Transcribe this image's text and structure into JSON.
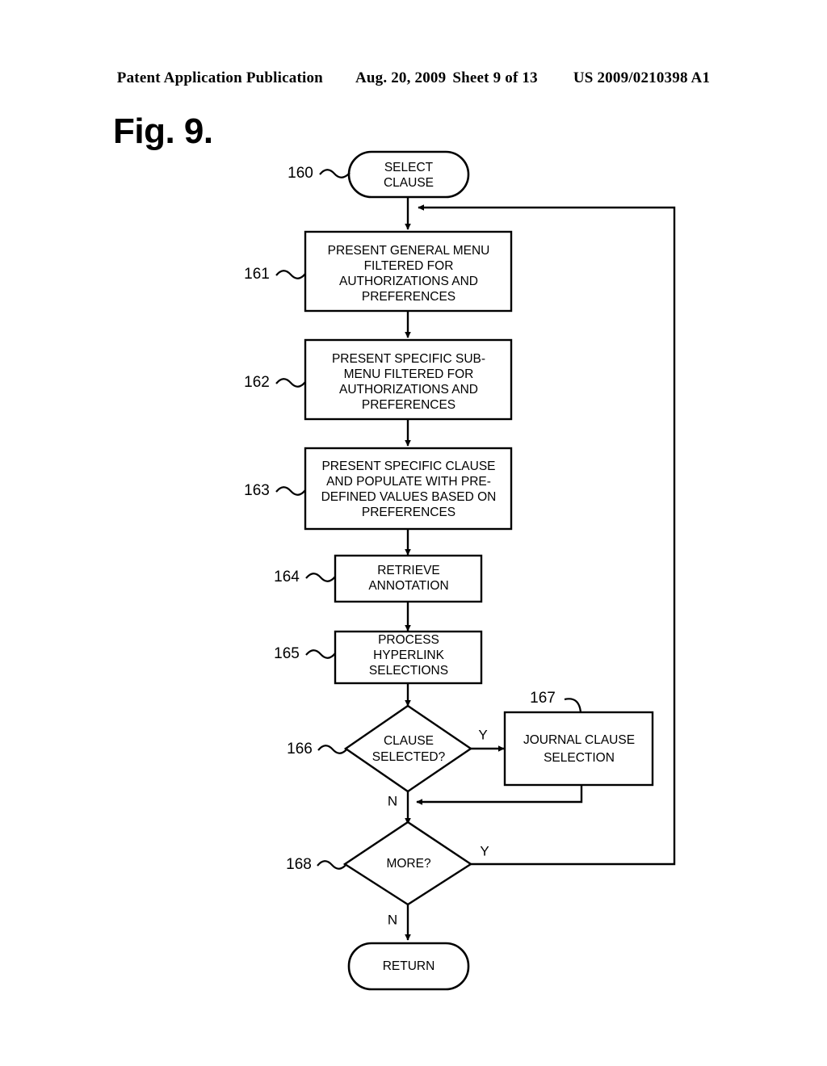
{
  "header": {
    "publication": "Patent Application Publication",
    "date": "Aug. 20, 2009",
    "sheet": "Sheet 9 of 13",
    "docket": "US 2009/0210398 A1"
  },
  "figure": {
    "label": "Fig. 9."
  },
  "nodes": [
    {
      "ref": "160",
      "type": "terminator",
      "text": "SELECT\nCLAUSE",
      "lines": [
        "SELECT",
        "CLAUSE"
      ]
    },
    {
      "ref": "161",
      "type": "process",
      "lines": [
        "PRESENT GENERAL MENU",
        "FILTERED FOR",
        "AUTHORIZATIONS AND",
        "PREFERENCES"
      ]
    },
    {
      "ref": "162",
      "type": "process",
      "lines": [
        "PRESENT SPECIFIC SUB-",
        "MENU FILTERED FOR",
        "AUTHORIZATIONS AND",
        "PREFERENCES"
      ]
    },
    {
      "ref": "163",
      "type": "process",
      "lines": [
        "PRESENT SPECIFIC CLAUSE",
        "AND POPULATE WITH PRE-",
        "DEFINED VALUES BASED ON",
        "PREFERENCES"
      ]
    },
    {
      "ref": "164",
      "type": "process",
      "lines": [
        "RETRIEVE",
        "ANNOTATION"
      ]
    },
    {
      "ref": "165",
      "type": "process",
      "lines": [
        "PROCESS",
        "HYPERLINK",
        "SELECTIONS"
      ]
    },
    {
      "ref": "166",
      "type": "decision",
      "lines": [
        "CLAUSE",
        "SELECTED?"
      ]
    },
    {
      "ref": "167",
      "type": "process",
      "lines": [
        "JOURNAL CLAUSE",
        "SELECTION"
      ]
    },
    {
      "ref": "168",
      "type": "decision",
      "lines": [
        "MORE?"
      ]
    },
    {
      "ref": "",
      "type": "terminator",
      "lines": [
        "RETURN"
      ]
    }
  ],
  "branch_labels": {
    "clause_selected_yes": "Y",
    "clause_selected_no": "N",
    "more_yes": "Y",
    "more_no": "N"
  },
  "colors": {
    "ink": "#000000",
    "paper": "#ffffff"
  }
}
